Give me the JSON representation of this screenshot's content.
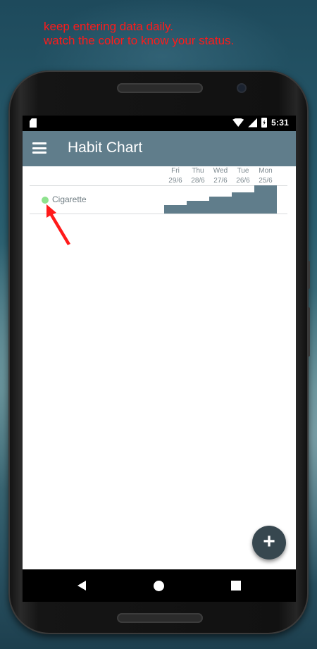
{
  "annotation": {
    "line1": "keep entering data daily.",
    "line2": "watch the color to know your status."
  },
  "status_bar": {
    "time": "5:31",
    "icons": [
      "sd-card-icon",
      "wifi-icon",
      "signal-icon",
      "battery-charging-icon"
    ]
  },
  "app_bar": {
    "menu_icon": "menu-icon",
    "title": "Habit Chart"
  },
  "chart": {
    "days": [
      {
        "weekday": "Fri",
        "date": "29/6"
      },
      {
        "weekday": "Thu",
        "date": "28/6"
      },
      {
        "weekday": "Wed",
        "date": "27/6"
      },
      {
        "weekday": "Tue",
        "date": "26/6"
      },
      {
        "weekday": "Mon",
        "date": "25/6"
      }
    ],
    "habits": [
      {
        "name": "Cigarette",
        "status_color": "#8ee28e",
        "levels": [
          0.3,
          0.45,
          0.6,
          0.75,
          1.0
        ]
      }
    ],
    "bar_color": "#607d8b"
  },
  "fab": {
    "label": "+",
    "icon": "plus-icon"
  },
  "nav_bar": {
    "icons": [
      "back-icon",
      "home-icon",
      "recent-apps-icon"
    ]
  },
  "colors": {
    "primary": "#607d8b",
    "fab": "#37474f",
    "annotation_text": "#ff1a1a"
  }
}
